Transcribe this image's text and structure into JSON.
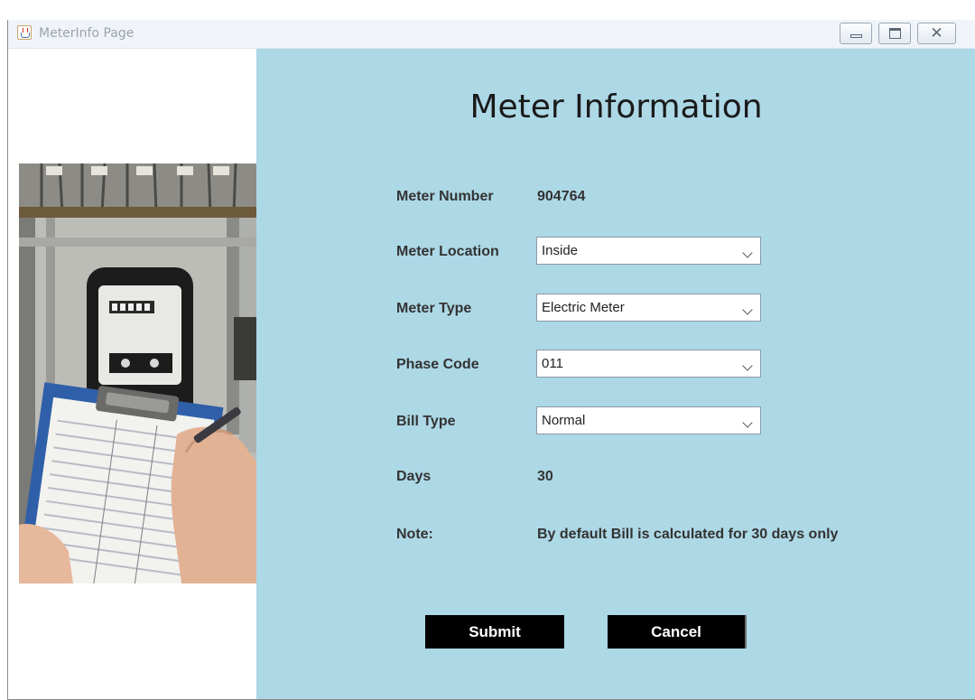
{
  "window": {
    "title": "MeterInfo Page"
  },
  "heading": "Meter Information",
  "form": {
    "meter_number": {
      "label": "Meter Number",
      "value": "904764"
    },
    "meter_location": {
      "label": "Meter Location",
      "selected": "Inside"
    },
    "meter_type": {
      "label": "Meter Type",
      "selected": "Electric Meter"
    },
    "phase_code": {
      "label": "Phase Code",
      "selected": "011"
    },
    "bill_type": {
      "label": "Bill Type",
      "selected": "Normal"
    },
    "days": {
      "label": "Days",
      "value": "30"
    },
    "note": {
      "label": "Note:",
      "value": "By default Bill is calculated for 30 days only"
    }
  },
  "buttons": {
    "submit": "Submit",
    "cancel": "Cancel"
  },
  "colors": {
    "panel_background": "#add8e6",
    "button_background": "#000000",
    "button_text": "#ffffff"
  },
  "icons": {
    "app": "java-cup-icon",
    "minimize": "minimize-icon",
    "maximize": "maximize-icon",
    "close": "close-icon",
    "dropdown": "chevron-down-icon"
  }
}
